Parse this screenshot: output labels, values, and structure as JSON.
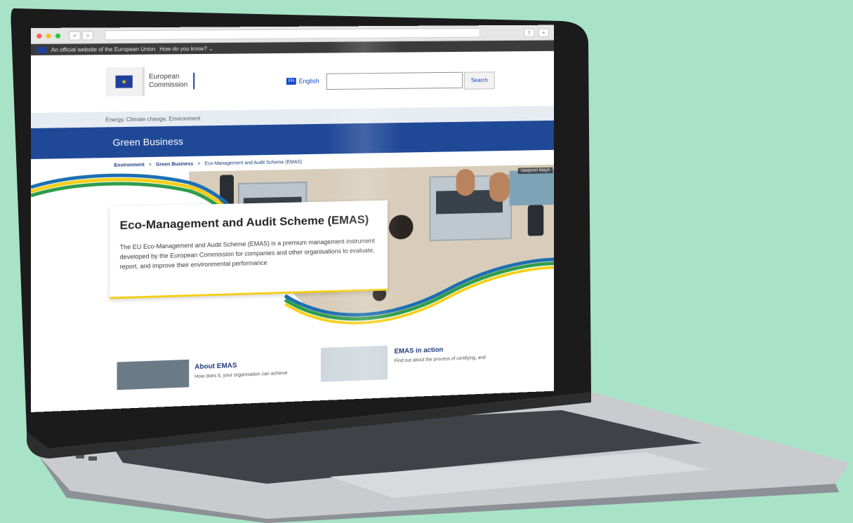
{
  "browser": {
    "back_label": "<",
    "forward_label": ">",
    "traffic_light_colors": [
      "#ff5f57",
      "#febc2e",
      "#28c840"
    ]
  },
  "eu_banner": {
    "official_text": "An official website of the European Union",
    "how_know_text": "How do you know? ⌄"
  },
  "header": {
    "logo_line1": "European",
    "logo_line2": "Commission",
    "language_label": "English",
    "search_placeholder": "",
    "search_button": "Search"
  },
  "site_strip": {
    "topics": "Energy, Climate change, Environment"
  },
  "site_title": "Green Business",
  "breadcrumb": {
    "items": [
      "Environment",
      "Green Business",
      "Eco-Management and Audit Scheme (EMAS)"
    ],
    "separator": ">"
  },
  "hero": {
    "title": "Eco-Management and Audit Scheme (EMAS)",
    "description": "The EU Eco-Management and Audit Scheme (EMAS) is a premium management instrument developed by the European Commission for companies and other organisations to evaluate, report, and improve their environmental performance",
    "photo_credit": "rawpixel Mayh"
  },
  "cards": [
    {
      "title": "About EMAS",
      "text": "How does it, your organisation can achieve"
    },
    {
      "title": "EMAS in action",
      "text": "Find out about the process of certifying, and"
    }
  ],
  "colors": {
    "background": "#a8e3c8",
    "eu_blue": "#1f4897",
    "eu_yellow": "#f3cf1a",
    "wave_green": "#2e9d4a"
  }
}
